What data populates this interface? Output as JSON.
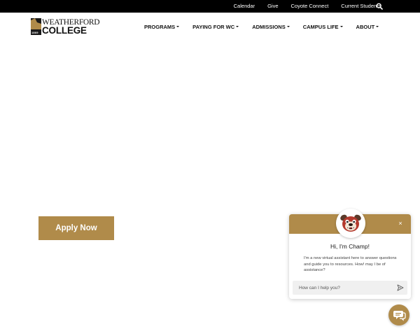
{
  "utility_nav": {
    "links": [
      "Calendar",
      "Give",
      "Coyote Connect",
      "Current Students"
    ],
    "search_icon": "search-icon"
  },
  "logo": {
    "line1": "WEATHERFORD",
    "line2": "COLLEGE",
    "year": "1869"
  },
  "main_nav": {
    "items": [
      "PROGRAMS",
      "PAYING FOR WC",
      "ADMISSIONS",
      "CAMPUS LIFE",
      "ABOUT"
    ]
  },
  "hero": {
    "apply_label": "Apply Now"
  },
  "chat": {
    "title": "Hi, I'm Champ!",
    "message": "I'm a new virtual assistant here to answer questions and guide you to resources. How! may I be of assistance?",
    "input_placeholder": "How can I help you?",
    "close_glyph": "×",
    "icons": {
      "close": "close-icon",
      "send": "send-icon",
      "avatar": "bulldog-mascot-avatar",
      "launcher": "chat-bubble-icon"
    }
  },
  "colors": {
    "gold": "#b08b4a",
    "black": "#000000",
    "white": "#ffffff"
  }
}
